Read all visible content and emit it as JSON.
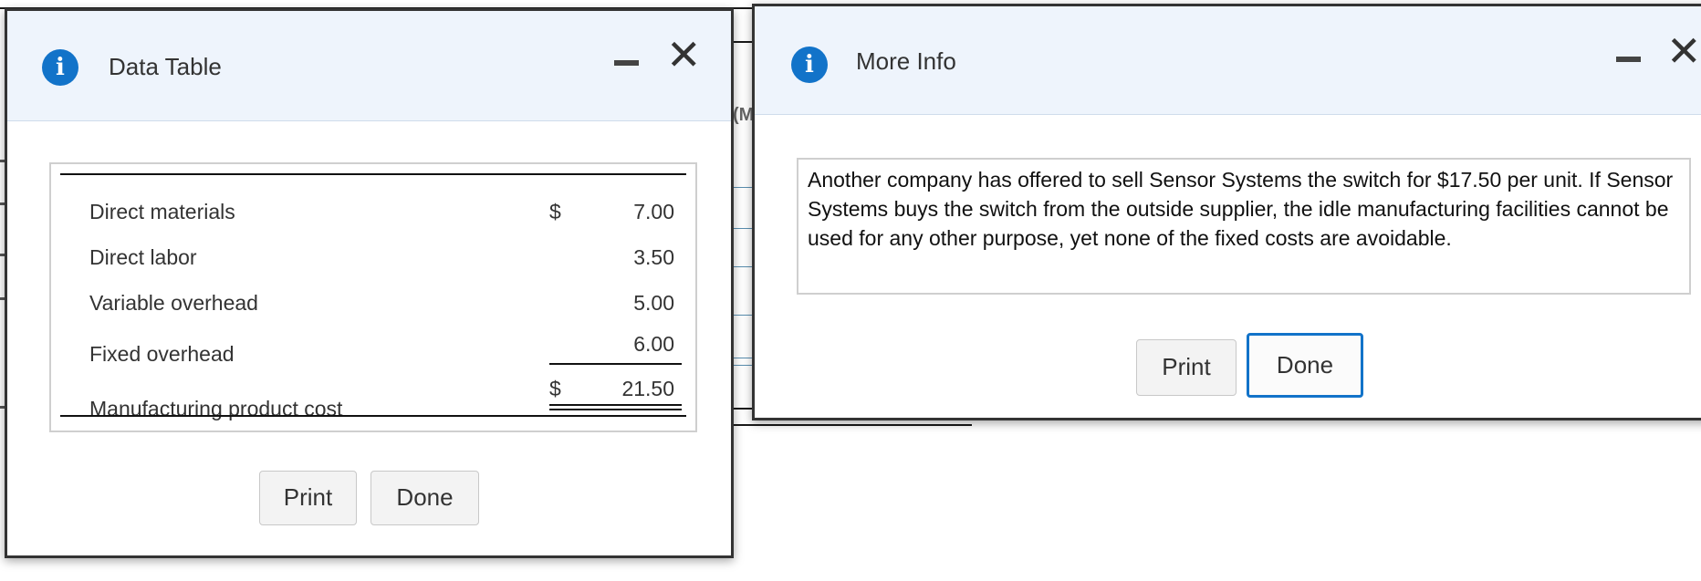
{
  "background": {
    "fragment_text": "(M"
  },
  "data_table_dialog": {
    "title": "Data Table",
    "icon": "info-icon",
    "rows": [
      {
        "label": "Direct materials",
        "currency": "$",
        "amount": "7.00"
      },
      {
        "label": "Direct labor",
        "currency": "",
        "amount": "3.50"
      },
      {
        "label": "Variable overhead",
        "currency": "",
        "amount": "5.00"
      },
      {
        "label": "Fixed overhead",
        "currency": "",
        "amount": "6.00"
      }
    ],
    "total": {
      "label": "Manufacturing product cost",
      "currency": "$",
      "amount": "21.50"
    },
    "print_label": "Print",
    "done_label": "Done"
  },
  "more_info_dialog": {
    "title": "More Info",
    "icon": "info-icon",
    "text": "Another company has offered to sell Sensor Systems the switch for $17.50 per unit. If Sensor Systems buys the switch from the outside supplier, the idle manufacturing facilities cannot be used for any other purpose, yet none of the fixed costs are avoidable.",
    "print_label": "Print",
    "done_label": "Done"
  },
  "colors": {
    "header_bg": "#eef4fc",
    "accent": "#1273c9",
    "border": "#333333"
  }
}
